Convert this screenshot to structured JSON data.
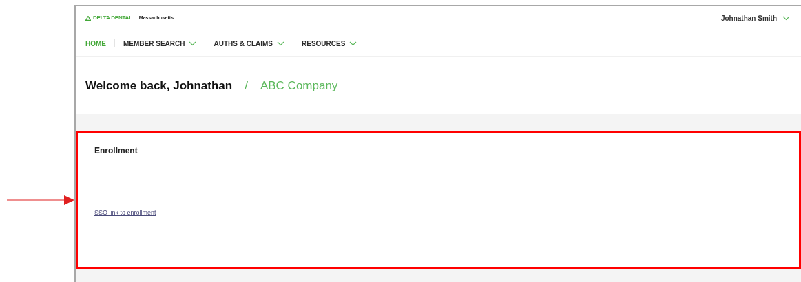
{
  "header": {
    "brand": "DELTA DENTAL",
    "region": "Massachusetts",
    "user": "Johnathan Smith"
  },
  "nav": [
    {
      "label": "HOME",
      "selected": true,
      "dropdown": false
    },
    {
      "label": "MEMBER SEARCH",
      "selected": false,
      "dropdown": true
    },
    {
      "label": "AUTHS & CLAIMS",
      "selected": false,
      "dropdown": true
    },
    {
      "label": "RESOURCES",
      "selected": false,
      "dropdown": true
    }
  ],
  "welcome": {
    "greeting": "Welcome back, Johnathan",
    "separator": "/",
    "company": "ABC Company"
  },
  "card": {
    "title": "Enrollment",
    "link": "SSO link to enrollment",
    "highlighted": true
  }
}
